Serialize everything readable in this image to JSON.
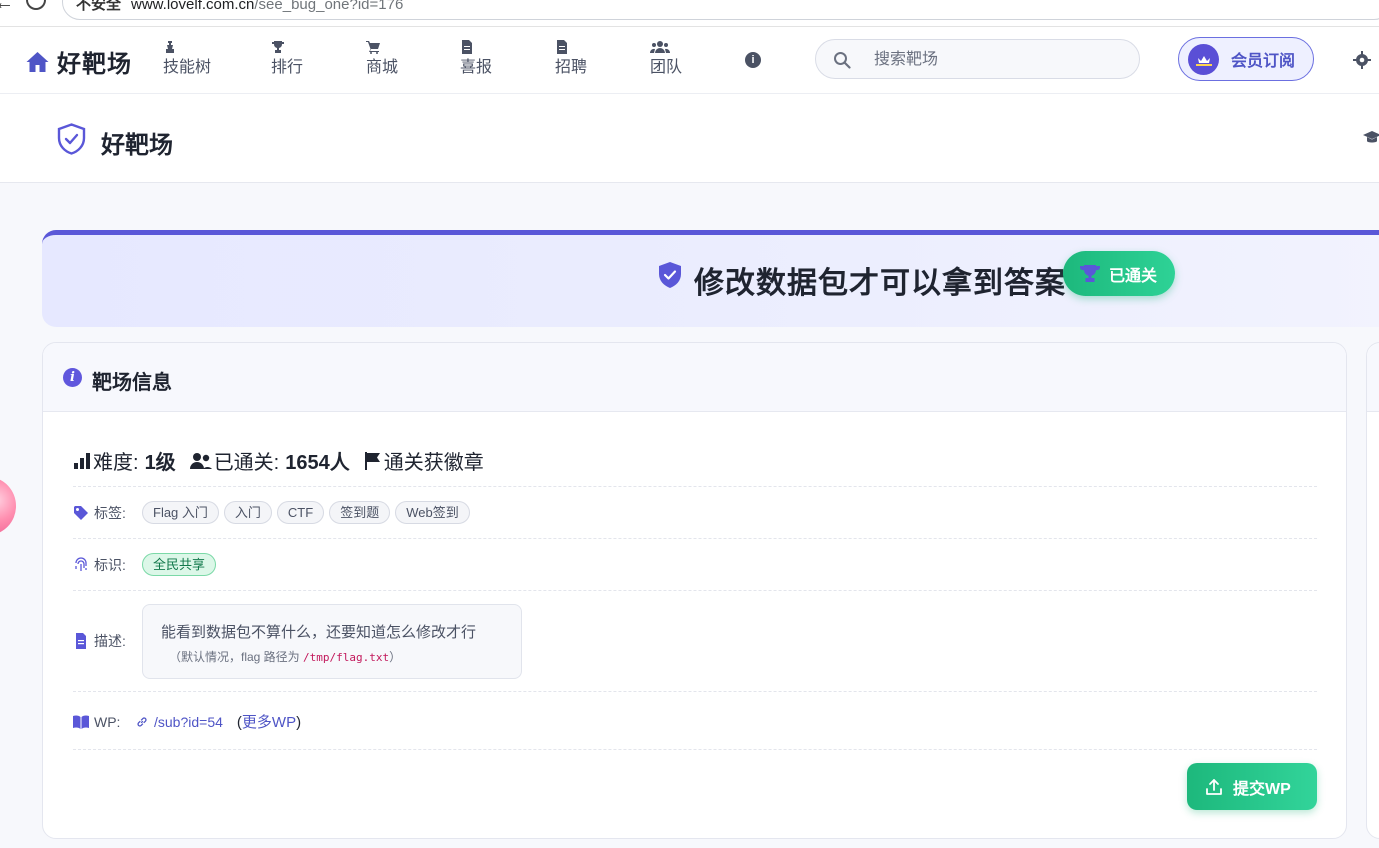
{
  "browser": {
    "security_label": "不安全",
    "url_host": "www.lovelf.com.cn",
    "url_path": "/see_bug_one?id=176"
  },
  "nav": {
    "brand": "好靶场",
    "items": [
      {
        "icon": "chess-icon",
        "label": "技能树"
      },
      {
        "icon": "trophy-icon",
        "label": "排行"
      },
      {
        "icon": "cart-icon",
        "label": "商城"
      },
      {
        "icon": "document-icon",
        "label": "喜报"
      },
      {
        "icon": "document-icon",
        "label": "招聘"
      },
      {
        "icon": "users-icon",
        "label": "团队"
      }
    ],
    "search_placeholder": "搜索靶场",
    "member_label": "会员订阅"
  },
  "subheader": {
    "title": "好靶场"
  },
  "hero": {
    "title": "修改数据包才可以拿到答案",
    "status_badge": "已通关"
  },
  "info_card": {
    "title": "靶场信息",
    "stats": {
      "difficulty_label": "难度:",
      "difficulty_value": "1级",
      "passed_label": "已通关:",
      "passed_value": "1654人",
      "badge_text": "通关获徽章"
    },
    "tags_label": "标签:",
    "tags": [
      "Flag 入门",
      "入门",
      "CTF",
      "签到题",
      "Web签到"
    ],
    "marks_label": "标识:",
    "marks": [
      "全民共享"
    ],
    "desc_label": "描述:",
    "desc_line1": "能看到数据包不算什么，还要知道怎么修改才行",
    "desc_line2_prefix": "（默认情况，flag 路径为",
    "desc_path": "/tmp/flag.txt",
    "desc_line2_suffix": "）",
    "wp_label": "WP:",
    "wp_link": "/sub?id=54",
    "wp_more_open": "(",
    "wp_more": "更多WP",
    "wp_more_close": ")",
    "submit_label": "提交WP"
  },
  "colors": {
    "accent": "#5a57d8",
    "success": "#1db87c",
    "link": "#4f55c6"
  }
}
